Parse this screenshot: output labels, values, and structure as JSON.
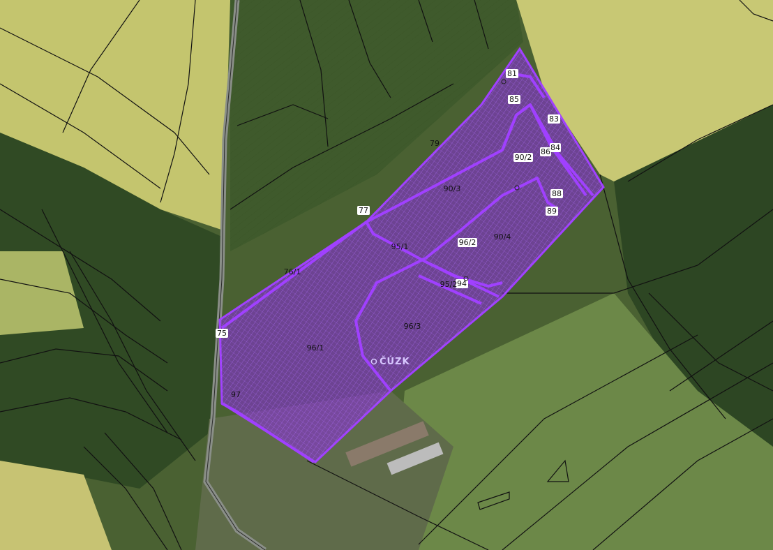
{
  "map": {
    "watermark": "ČÚZK",
    "colors": {
      "highlight_fill": "#8a2be2",
      "highlight_stroke": "#9b30ff",
      "field_yellow": "#c9c873",
      "field_green": "#4f6a36",
      "forest": "#2f4a25",
      "meadow": "#6f8a4a"
    },
    "parcels": [
      {
        "label": "81"
      },
      {
        "label": "85"
      },
      {
        "label": "83"
      },
      {
        "label": "79"
      },
      {
        "label": "90/2"
      },
      {
        "label": "86"
      },
      {
        "label": "84"
      },
      {
        "label": "90/3"
      },
      {
        "label": "88"
      },
      {
        "label": "77"
      },
      {
        "label": "89"
      },
      {
        "label": "95/1"
      },
      {
        "label": "96/2"
      },
      {
        "label": "90/4"
      },
      {
        "label": "76/1"
      },
      {
        "label": "94"
      },
      {
        "label": "95/2"
      },
      {
        "label": "96/3"
      },
      {
        "label": "75"
      },
      {
        "label": "96/1"
      },
      {
        "label": "97"
      }
    ]
  }
}
